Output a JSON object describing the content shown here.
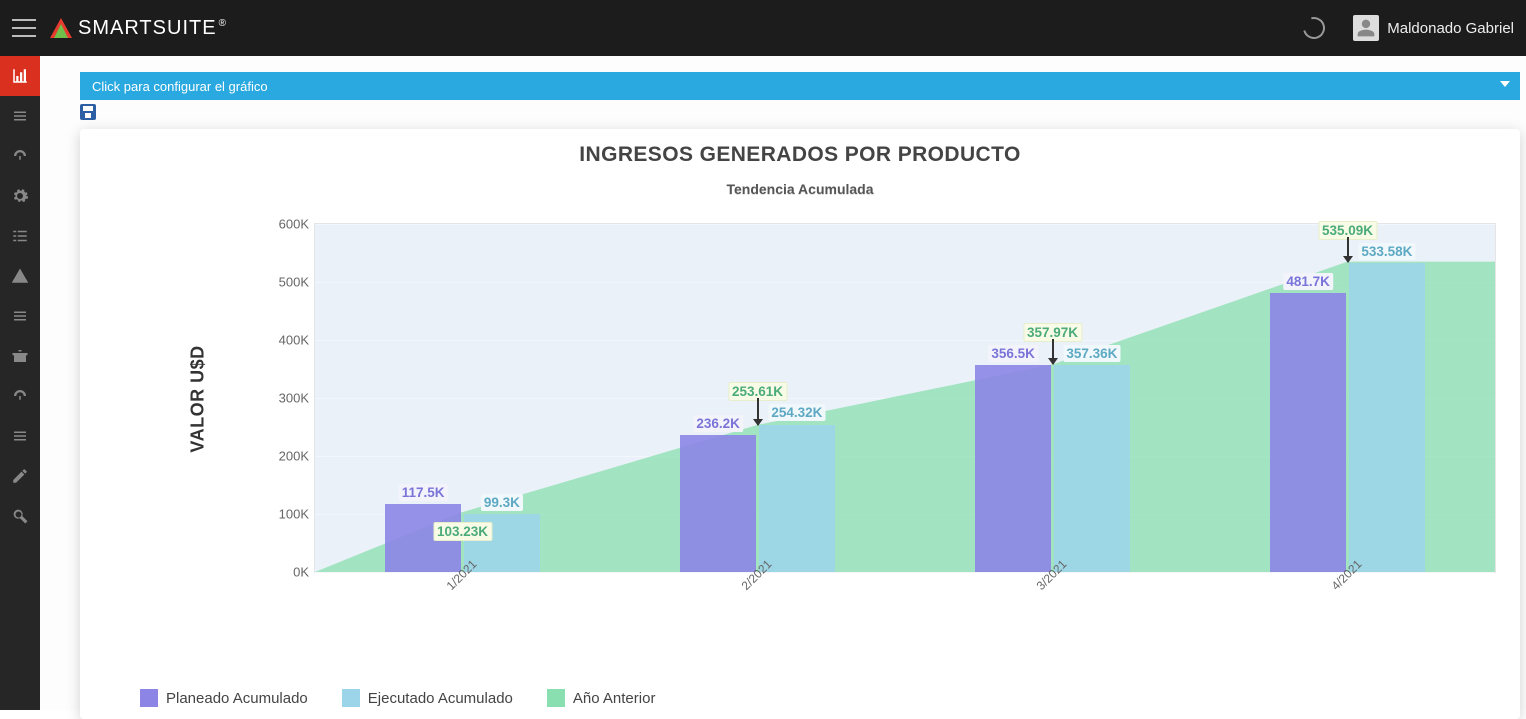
{
  "header": {
    "brand": "SMARTSUITE",
    "user_name": "Maldonado Gabriel"
  },
  "config_bar": {
    "label": "Click para configurar el gráfico"
  },
  "chart_data": {
    "type": "bar",
    "title": "INGRESOS GENERADOS POR PRODUCTO",
    "subtitle": "Tendencia Acumulada",
    "ylabel": "VALOR U$D",
    "xlabel": "",
    "ylim": [
      0,
      600
    ],
    "yticks": [
      "0K",
      "100K",
      "200K",
      "300K",
      "400K",
      "500K",
      "600K"
    ],
    "categories": [
      "1/2021",
      "2/2021",
      "3/2021",
      "4/2021"
    ],
    "series": [
      {
        "name": "Planeado Acumulado",
        "role": "plan",
        "values": [
          117.5,
          236.2,
          356.5,
          481.7
        ],
        "labels": [
          "117.5K",
          "236.2K",
          "356.5K",
          "481.7K"
        ]
      },
      {
        "name": "Ejecutado Acumulado",
        "role": "exec",
        "values": [
          99.3,
          254.32,
          357.36,
          533.58
        ],
        "labels": [
          "99.3K",
          "254.32K",
          "357.36K",
          "533.58K"
        ]
      },
      {
        "name": "Año Anterior",
        "role": "prev",
        "values": [
          103.23,
          253.61,
          357.97,
          535.09
        ],
        "labels": [
          "103.23K",
          "253.61K",
          "357.97K",
          "535.09K"
        ]
      }
    ],
    "legend": [
      "Planeado Acumulado",
      "Ejecutado Acumulado",
      "Año Anterior"
    ]
  }
}
